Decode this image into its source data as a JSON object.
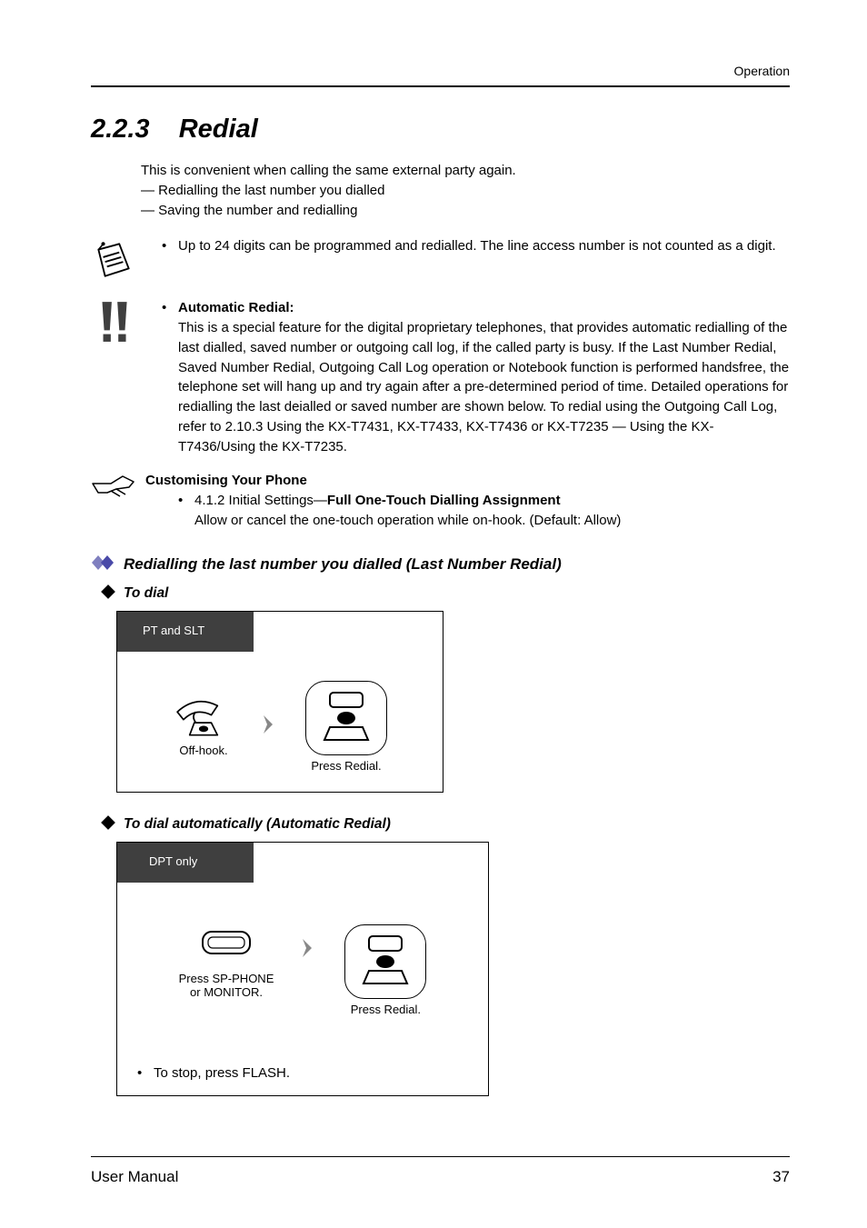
{
  "header": {
    "chapter": "Operation"
  },
  "section": {
    "number": "2.2.3",
    "title": "Redial"
  },
  "intro": {
    "lead": "This is convenient when calling the same external party again.",
    "line1": "— Redialling the last number you dialled",
    "line2": "— Saving the number and redialling"
  },
  "notes": {
    "note1": "Up to 24 digits can be programmed and redialled. The line access number is not counted as a digit.",
    "auto_label": "Automatic Redial:",
    "auto_body": "This is a special feature for the digital proprietary telephones, that provides automatic redialling of the last dialled, saved number or outgoing call log, if the called party is busy. If the Last Number Redial, Saved Number Redial, Outgoing Call Log operation or Notebook function is performed handsfree, the telephone set will hang up and try again after a pre-determined period of time. Detailed operations for redialling the last deialled or saved number are shown below. To redial using the Outgoing Call Log, refer to 2.10.3    Using the KX-T7431, KX-T7433, KX-T7436 or KX-T7235 — Using the KX-T7436/Using the KX-T7235."
  },
  "customise": {
    "heading": "Customising Your Phone",
    "ref": "4.1.2    Initial Settings—",
    "bold": "Full One-Touch Dialling Assignment",
    "desc": "Allow or cancel the one-touch operation while on-hook. (Default: Allow)"
  },
  "sub1": {
    "title": "Redialling the last number you dialled (Last Number Redial)"
  },
  "step1": {
    "title": "To dial"
  },
  "step2": {
    "title": "To dial automatically (Automatic Redial)"
  },
  "diagram1": {
    "box_label_top": "PT and SLT",
    "offhook": "Off-hook.",
    "press": "Press Redial."
  },
  "diagram2": {
    "box_label_top": "DPT only",
    "sp_label": "Press SP-PHONE\nor MONITOR.",
    "press": "Press Redial.",
    "stop": "To stop, press FLASH."
  },
  "footer": {
    "left": "User Manual",
    "page": "37"
  },
  "icons": {
    "notepad": "notepad-icon",
    "warning": "exclamation-icon",
    "hand": "pointing-hand-icon",
    "diamond_dual": "dual-diamond-icon",
    "diamond": "diamond-icon"
  }
}
